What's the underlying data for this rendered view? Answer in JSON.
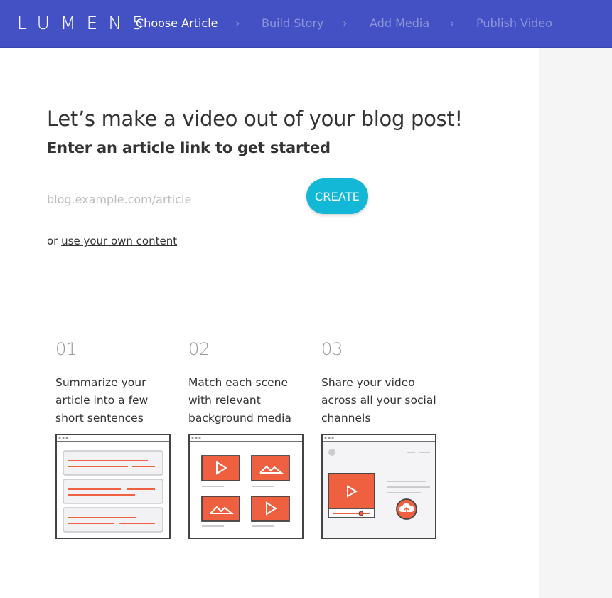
{
  "header": {
    "logo": "LUMEN5",
    "nav": [
      {
        "label": "Choose Article",
        "active": true
      },
      {
        "label": "Build Story",
        "active": false
      },
      {
        "label": "Add Media",
        "active": false
      },
      {
        "label": "Publish Video",
        "active": false
      }
    ],
    "separator": "›"
  },
  "main": {
    "headline": "Let’s make a video out of your blog post!",
    "subhead": "Enter an article link to get started",
    "url_input": {
      "placeholder": "blog.example.com/article",
      "value": ""
    },
    "create_label": "CREATE",
    "alt_prefix": "or",
    "alt_link": "use your own content"
  },
  "steps": [
    {
      "num": "01",
      "text": "Summarize your article into a few short sentences"
    },
    {
      "num": "02",
      "text": "Match each scene with relevant background media"
    },
    {
      "num": "03",
      "text": "Share your video across all your social channels"
    }
  ],
  "colors": {
    "header_bg": "#4351c4",
    "accent": "#12b8d6",
    "illustration_orange": "#ee6040"
  }
}
